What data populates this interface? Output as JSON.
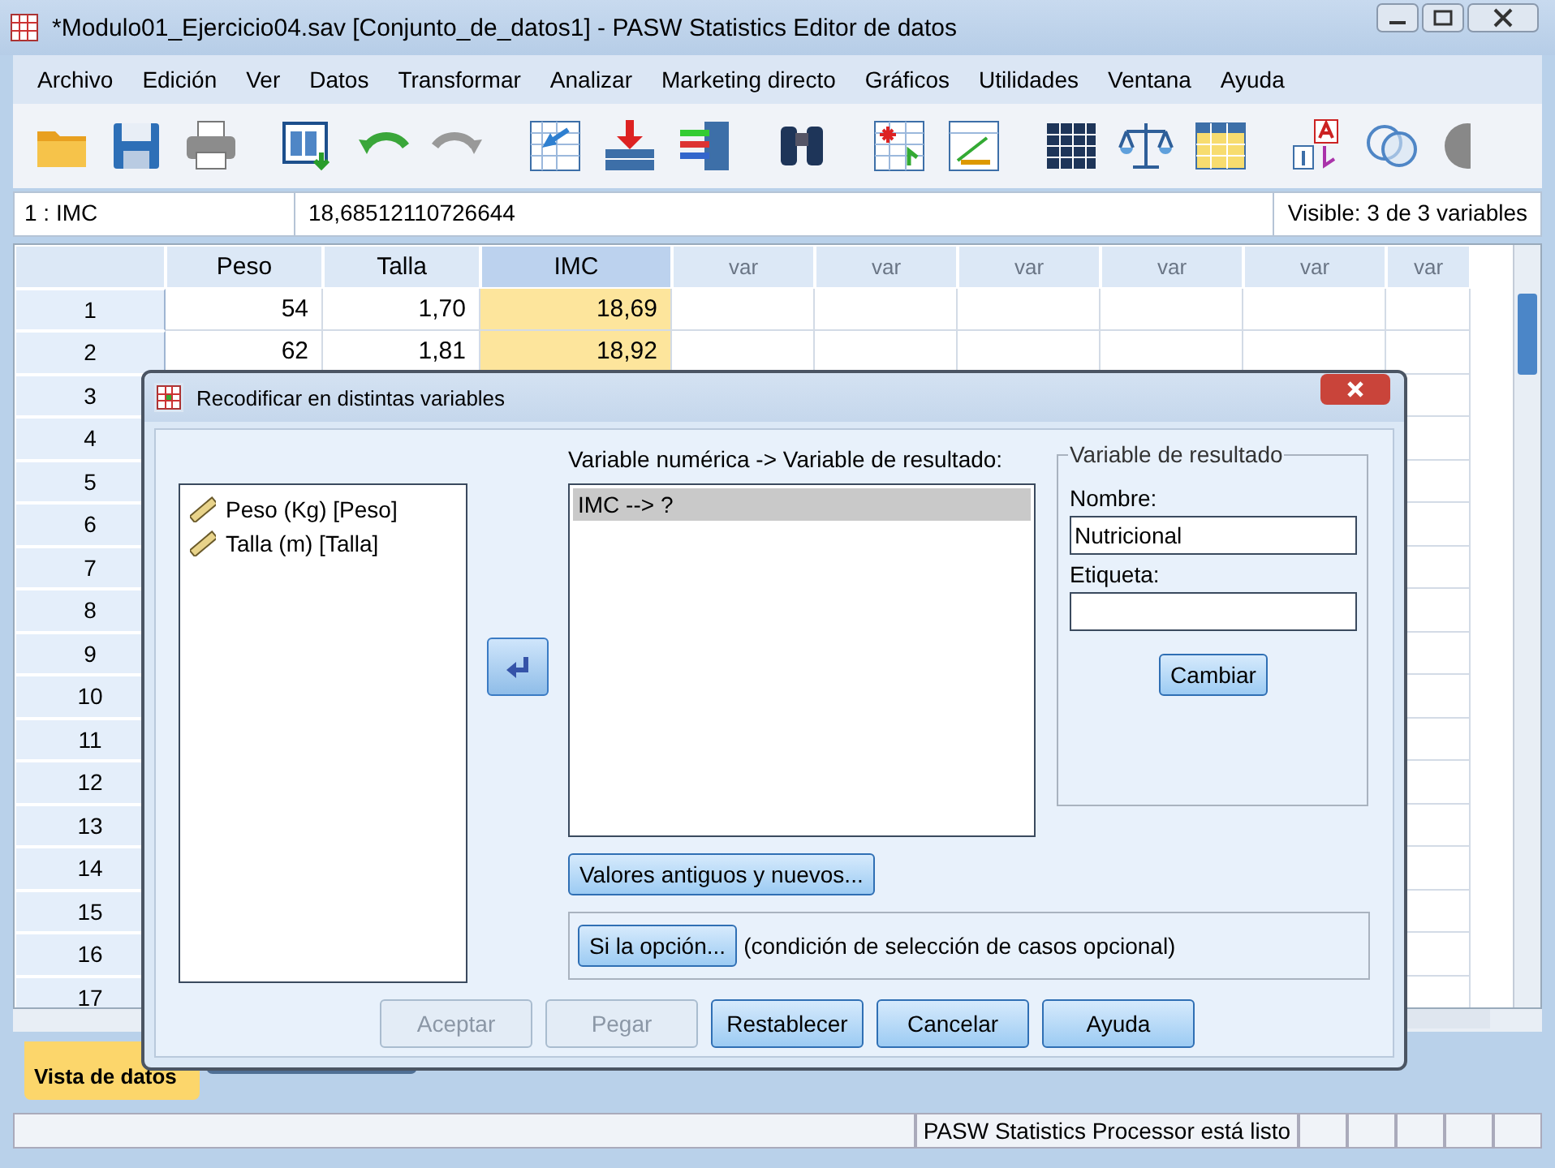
{
  "window": {
    "title": "*Modulo01_Ejercicio04.sav [Conjunto_de_datos1] - PASW Statistics Editor de datos"
  },
  "menu": [
    "Archivo",
    "Edición",
    "Ver",
    "Datos",
    "Transformar",
    "Analizar",
    "Marketing directo",
    "Gráficos",
    "Utilidades",
    "Ventana",
    "Ayuda"
  ],
  "cell_editor": {
    "reference": "1 : IMC",
    "value": "18,68512110726644",
    "visible": "Visible: 3 de 3 variables"
  },
  "grid": {
    "columns": [
      {
        "label": "Peso",
        "selected": false,
        "kind": "data"
      },
      {
        "label": "Talla",
        "selected": false,
        "kind": "data"
      },
      {
        "label": "IMC",
        "selected": true,
        "kind": "data"
      },
      {
        "label": "var",
        "selected": false,
        "kind": "empty"
      },
      {
        "label": "var",
        "selected": false,
        "kind": "empty"
      },
      {
        "label": "var",
        "selected": false,
        "kind": "empty"
      },
      {
        "label": "var",
        "selected": false,
        "kind": "empty"
      },
      {
        "label": "var",
        "selected": false,
        "kind": "empty"
      },
      {
        "label": "var",
        "selected": false,
        "kind": "empty"
      }
    ],
    "rows": [
      {
        "number": "1",
        "cells": [
          "54",
          "1,70",
          "18,69"
        ]
      },
      {
        "number": "2",
        "cells": [
          "62",
          "1,81",
          "18,92"
        ]
      },
      {
        "number": "3",
        "cells": []
      },
      {
        "number": "4",
        "cells": []
      },
      {
        "number": "5",
        "cells": []
      },
      {
        "number": "6",
        "cells": []
      },
      {
        "number": "7",
        "cells": []
      },
      {
        "number": "8",
        "cells": []
      },
      {
        "number": "9",
        "cells": []
      },
      {
        "number": "10",
        "cells": []
      },
      {
        "number": "11",
        "cells": []
      },
      {
        "number": "12",
        "cells": []
      },
      {
        "number": "13",
        "cells": []
      },
      {
        "number": "14",
        "cells": []
      },
      {
        "number": "15",
        "cells": []
      },
      {
        "number": "16",
        "cells": []
      },
      {
        "number": "17",
        "cells": []
      }
    ]
  },
  "tabs": [
    {
      "label": "Vista de datos",
      "selected": true
    }
  ],
  "status_bar": {
    "text": "PASW Statistics Processor está listo"
  },
  "dialog": {
    "title": "Recodificar en distintas variables",
    "source_items": [
      "Peso (Kg) [Peso]",
      "Talla (m) [Talla]"
    ],
    "target_label": "Variable numérica -> Variable de resultado:",
    "target_items": [
      {
        "text": "IMC --> ?",
        "selected": true
      }
    ],
    "output_group": {
      "title": "Variable de resultado",
      "name_label": "Nombre:",
      "name_value": "Nutricional",
      "label_label": "Etiqueta:",
      "change_button": "Cambiar"
    },
    "old_new_button": "Valores antiguos y nuevos...",
    "if_button": "Si la opción...",
    "if_note": "(condición de selección de casos opcional)",
    "buttons": [
      {
        "label": "Aceptar",
        "disabled": true
      },
      {
        "label": "Pegar",
        "disabled": true
      },
      {
        "label": "Restablecer",
        "disabled": false
      },
      {
        "label": "Cancelar",
        "disabled": false
      },
      {
        "label": "Ayuda",
        "disabled": false
      }
    ]
  }
}
